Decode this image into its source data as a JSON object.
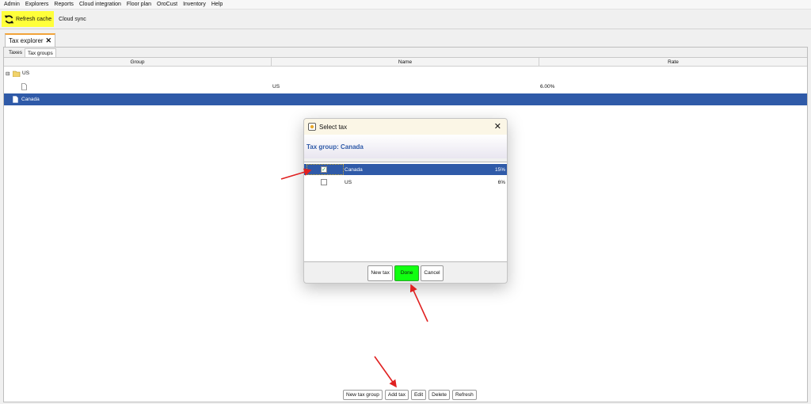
{
  "menu": [
    "Admin",
    "Explorers",
    "Reports",
    "Cloud integration",
    "Floor plan",
    "OroCust",
    "Inventory",
    "Help"
  ],
  "toolbar": {
    "refresh_label": "Refresh cache",
    "cloud_label": "Cloud sync"
  },
  "doc_tab": {
    "label": "Tax explorer",
    "close": "✕"
  },
  "subtabs": [
    "Taxes",
    "Tax groups"
  ],
  "grid": {
    "columns": [
      "Group",
      "Name",
      "Rate"
    ],
    "rows": [
      {
        "expander": "⊟",
        "group": "US",
        "name": "",
        "rate": ""
      },
      {
        "group": "",
        "name": "US",
        "rate": "6.00%"
      },
      {
        "group": "Canada",
        "name": "",
        "rate": "",
        "selected": true
      }
    ]
  },
  "dialog": {
    "title": "Select tax",
    "close": "✕",
    "header": "Tax group: Canada",
    "items": [
      {
        "name": "Canada",
        "rate": "15%",
        "checked": true,
        "check_mark": "✓"
      },
      {
        "name": "US",
        "rate": "6%",
        "checked": false,
        "check_mark": ""
      }
    ],
    "buttons": {
      "new_tax": "New tax",
      "done": "Done",
      "cancel": "Cancel"
    }
  },
  "bottom_buttons": [
    "New tax group",
    "Add tax",
    "Edit",
    "Delete",
    "Refresh"
  ],
  "colors": {
    "selection": "#2f5aa8",
    "highlight_yellow": "#ffff3a",
    "done_green": "#11ff11",
    "annotation_arrow": "#e02020"
  }
}
